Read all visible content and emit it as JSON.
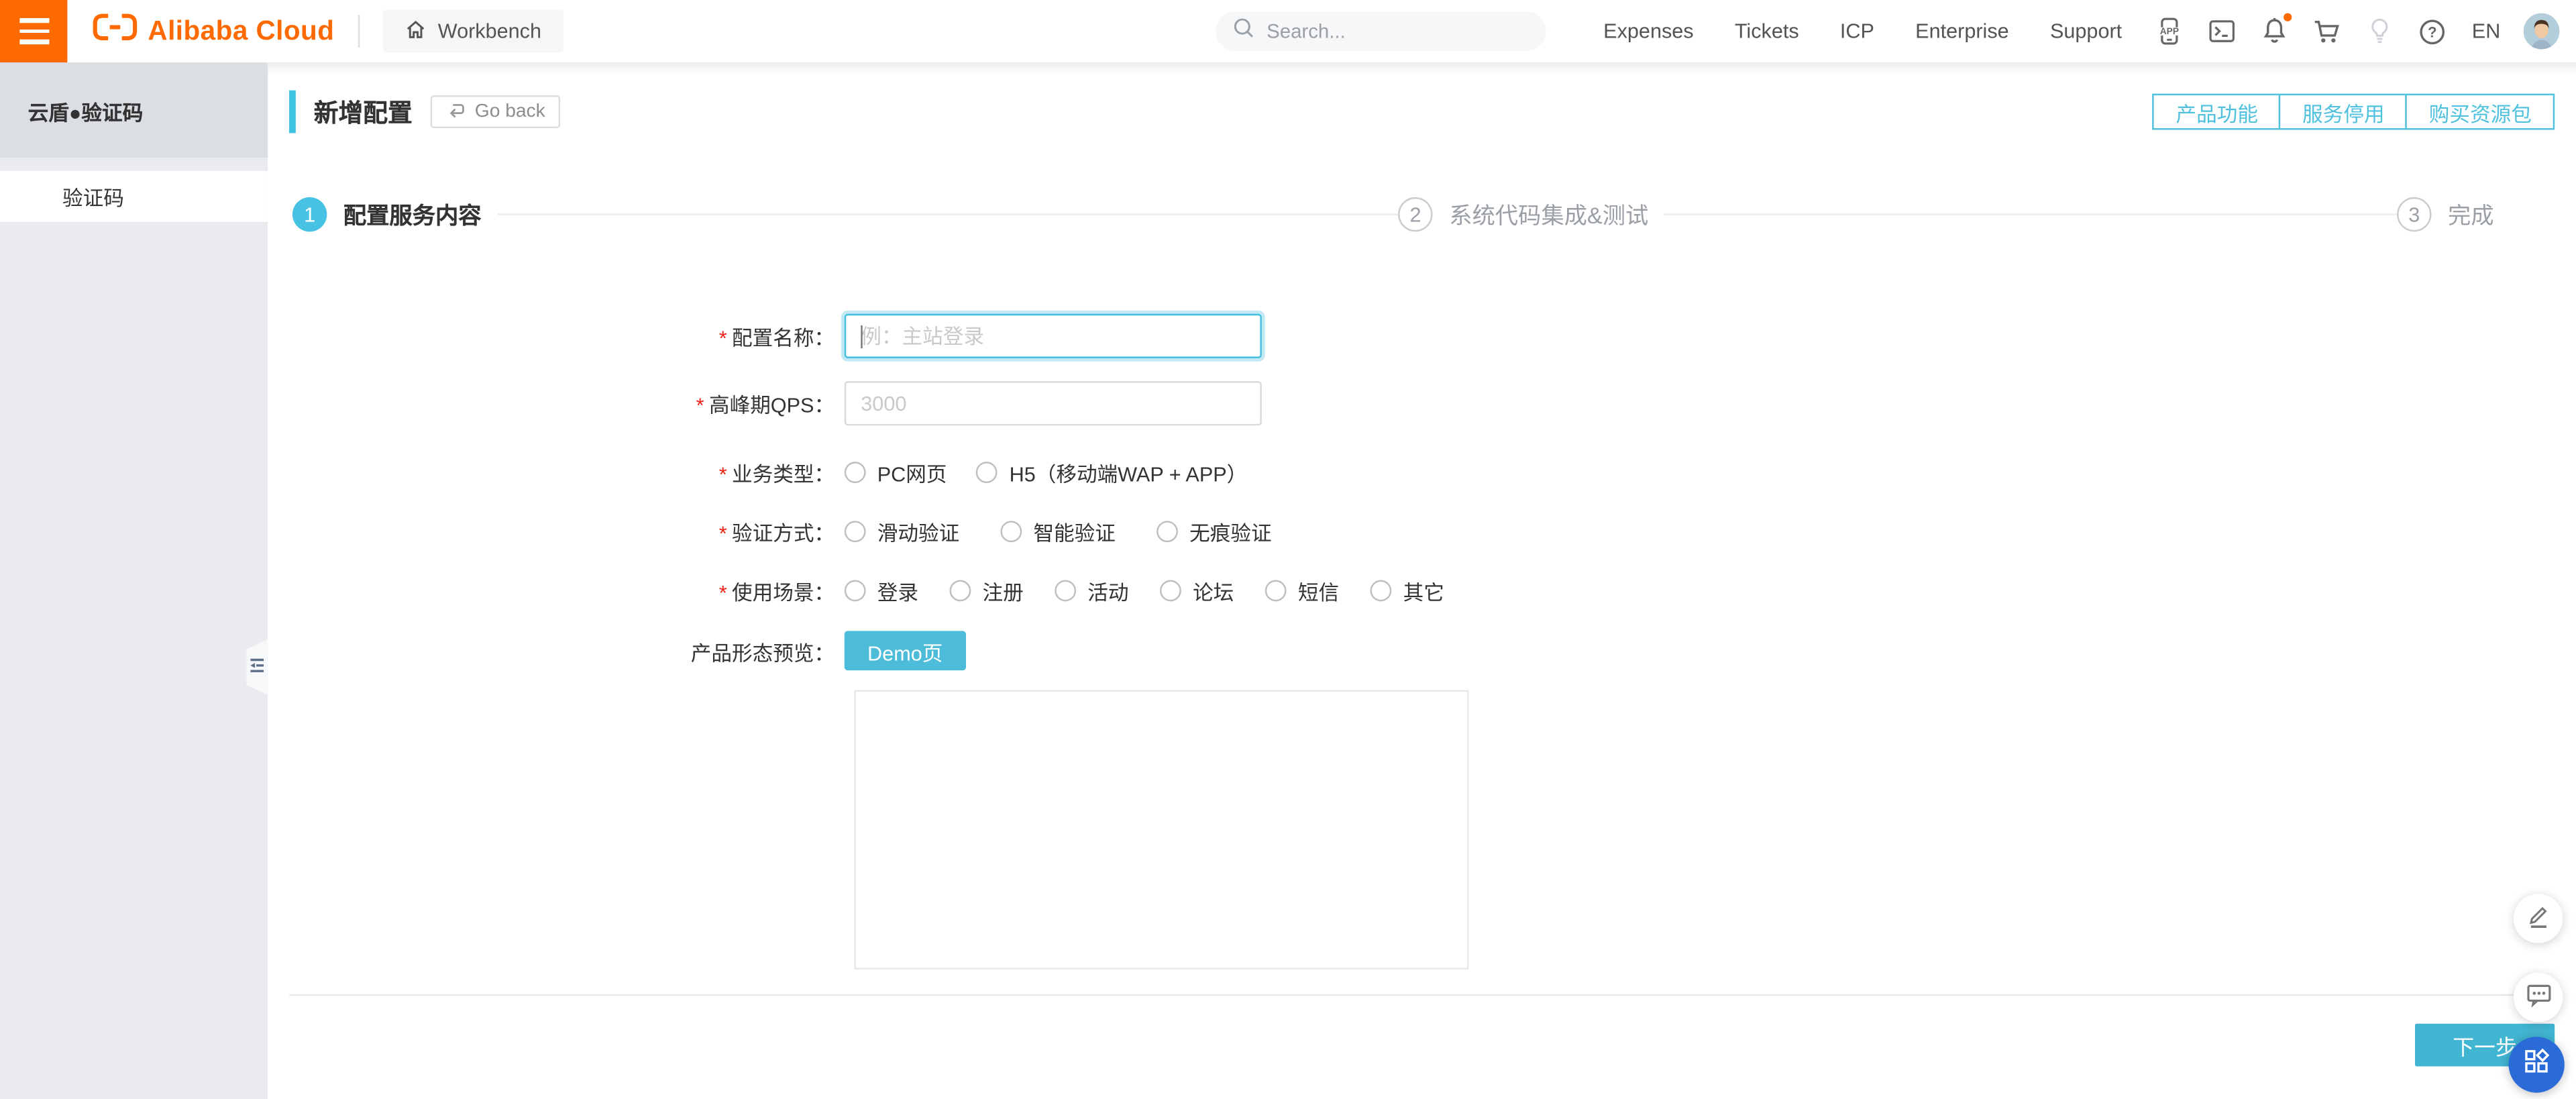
{
  "header": {
    "workbench": "Workbench",
    "search_placeholder": "Search...",
    "nav": [
      "Expenses",
      "Tickets",
      "ICP",
      "Enterprise",
      "Support"
    ],
    "lang": "EN"
  },
  "sidebar": {
    "product_title": "云盾●验证码",
    "items": [
      {
        "label": "验证码",
        "selected": true
      }
    ]
  },
  "page": {
    "title": "新增配置",
    "go_back": "Go back",
    "actions": [
      "产品功能",
      "服务停用",
      "购买资源包"
    ]
  },
  "steps": [
    {
      "num": "1",
      "label": "配置服务内容",
      "active": true
    },
    {
      "num": "2",
      "label": "系统代码集成&测试",
      "active": false
    },
    {
      "num": "3",
      "label": "完成",
      "active": false
    }
  ],
  "form": {
    "required_mark": "*",
    "config_name": {
      "label": "配置名称：",
      "placeholder": "例：主站登录",
      "value": ""
    },
    "peak_qps": {
      "label": "高峰期QPS：",
      "placeholder": "3000",
      "value": ""
    },
    "business_type": {
      "label": "业务类型：",
      "options": [
        "PC网页",
        "H5（移动端WAP + APP）"
      ]
    },
    "verify_method": {
      "label": "验证方式：",
      "options": [
        "滑动验证",
        "智能验证",
        "无痕验证"
      ]
    },
    "usage_scene": {
      "label": "使用场景：",
      "options": [
        "登录",
        "注册",
        "活动",
        "论坛",
        "短信",
        "其它"
      ]
    },
    "preview": {
      "label": "产品形态预览：",
      "demo_button": "Demo页"
    }
  },
  "footer": {
    "next_button": "下一步"
  },
  "colors": {
    "accent_teal": "#47c2e2",
    "brand_orange": "#FF6A00",
    "fab_blue": "#2b6bd8",
    "required_red": "#ee2117"
  }
}
